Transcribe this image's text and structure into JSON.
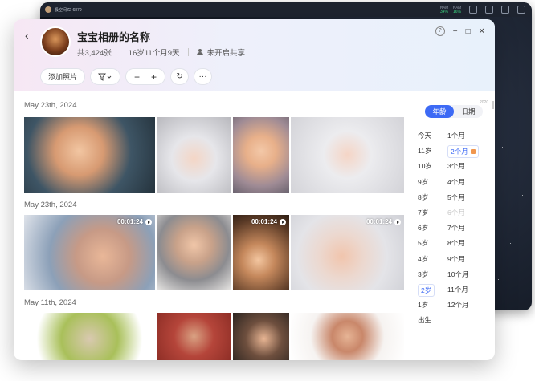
{
  "background_window": {
    "title": "极空间Z2-6879",
    "ram_label": "RAM",
    "ram_value": "34%",
    "ram2_label": "RAM",
    "ram2_value": "16%"
  },
  "album": {
    "title": "宝宝相册的名称",
    "count": "共3,424张",
    "age": "16岁11个月9天",
    "share_status": "未开启共享"
  },
  "toolbar": {
    "add_photo": "添加照片",
    "filter_icon": "filter-icon",
    "zoom_out": "−",
    "zoom_in": "+",
    "refresh": "↻",
    "more": "···"
  },
  "window_controls": {
    "help": "?",
    "minimize": "−",
    "maximize": "□",
    "close": "✕"
  },
  "sections": [
    {
      "date": "May 23th, 2024"
    },
    {
      "date": "May 23th, 2024",
      "durations": [
        "00:01:24",
        "00:01:24",
        "00:01:24"
      ]
    },
    {
      "date": "May 11th, 2024"
    }
  ],
  "side_index": {
    "tabs": [
      "年龄",
      "日期"
    ],
    "active_tab": "年龄",
    "year_hint": "2020",
    "years": [
      "今天",
      "11岁",
      "10岁",
      "9岁",
      "8岁",
      "7岁",
      "6岁",
      "5岁",
      "4岁",
      "3岁",
      "2岁",
      "1岁",
      "出生"
    ],
    "months": [
      "1个月",
      "2个月",
      "3个月",
      "4个月",
      "5个月",
      "6个月",
      "7个月",
      "8个月",
      "9个月",
      "10个月",
      "11个月",
      "12个月"
    ],
    "selected_year": "2岁",
    "selected_month": "2个月",
    "dim_month": "6个月"
  },
  "colors": {
    "accent": "#3d6af5",
    "header_start": "#f6e7f4",
    "header_end": "#e8f1fb"
  }
}
